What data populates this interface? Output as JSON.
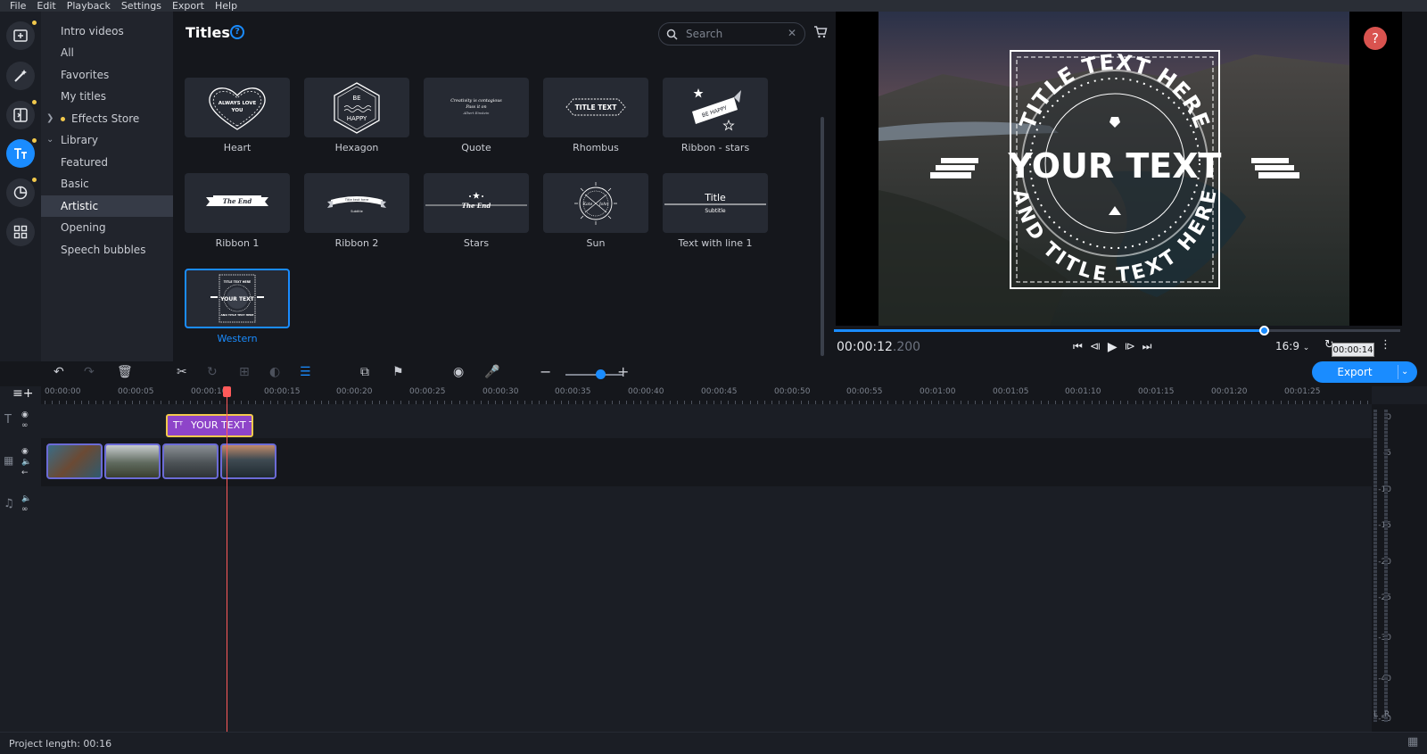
{
  "menu": [
    "File",
    "Edit",
    "Playback",
    "Settings",
    "Export",
    "Help"
  ],
  "categories": [
    {
      "label": "Intro videos"
    },
    {
      "label": "All"
    },
    {
      "label": "Favorites"
    },
    {
      "label": "My titles"
    },
    {
      "label": "Effects Store"
    },
    {
      "label": "Library"
    },
    {
      "label": "Featured"
    },
    {
      "label": "Basic"
    },
    {
      "label": "Artistic"
    },
    {
      "label": "Opening"
    },
    {
      "label": "Speech bubbles"
    }
  ],
  "titles_panel": {
    "heading": "Titles",
    "help": "?",
    "search_placeholder": "Search",
    "tiles": [
      {
        "label": "Heart",
        "preview": [
          "ALWAYS LOVE",
          "YOU"
        ]
      },
      {
        "label": "Hexagon",
        "preview": [
          "BE",
          "HAPPY"
        ]
      },
      {
        "label": "Quote",
        "preview": [
          "Creativity is contagious",
          "Pass it on",
          "Albert Einstein"
        ]
      },
      {
        "label": "Rhombus",
        "preview": [
          "TITLE TEXT"
        ]
      },
      {
        "label": "Ribbon - stars",
        "preview": [
          "BE HAPPY"
        ]
      },
      {
        "label": "Ribbon 1",
        "preview": [
          "The End"
        ]
      },
      {
        "label": "Ribbon 2",
        "preview": [
          "Title text here",
          "Subtitle"
        ]
      },
      {
        "label": "Stars",
        "preview": [
          "The End"
        ]
      },
      {
        "label": "Sun",
        "preview": [
          "Kate",
          "John"
        ]
      },
      {
        "label": "Text with line 1",
        "preview": [
          "Title",
          "Subtitle"
        ]
      },
      {
        "label": "Western",
        "preview": [
          "TITLE TEXT HERE",
          "YOUR TEXT",
          "AND TITLE TEXT HERE"
        ]
      }
    ]
  },
  "preview": {
    "overlay_top": "TITLE TEXT HERE",
    "overlay_main": "YOUR TEXT",
    "overlay_bottom": "AND TITLE TEXT HERE",
    "help": "?",
    "timecode": "00:00:12",
    "timecode_ms": ".200",
    "aspect": "16:9",
    "tooltip": "00:00:14",
    "progress_fraction": 0.76
  },
  "export_label": "Export",
  "ruler_labels": [
    "00:00:00",
    "00:00:05",
    "00:00:10",
    "00:00:15",
    "00:00:20",
    "00:00:25",
    "00:00:30",
    "00:00:35",
    "00:00:40",
    "00:00:45",
    "00:00:50",
    "00:00:55",
    "00:01:00",
    "00:01:05",
    "00:01:10",
    "00:01:15",
    "00:01:20",
    "00:01:25"
  ],
  "title_clip_text": "YOUR TEXT T",
  "meter_labels": [
    "0",
    "-5",
    "-10",
    "-15",
    "-20",
    "-25",
    "-30",
    "-40",
    "-50",
    "-60"
  ],
  "meter_channels": [
    "L",
    "R"
  ],
  "project_length": "Project length: 00:16"
}
